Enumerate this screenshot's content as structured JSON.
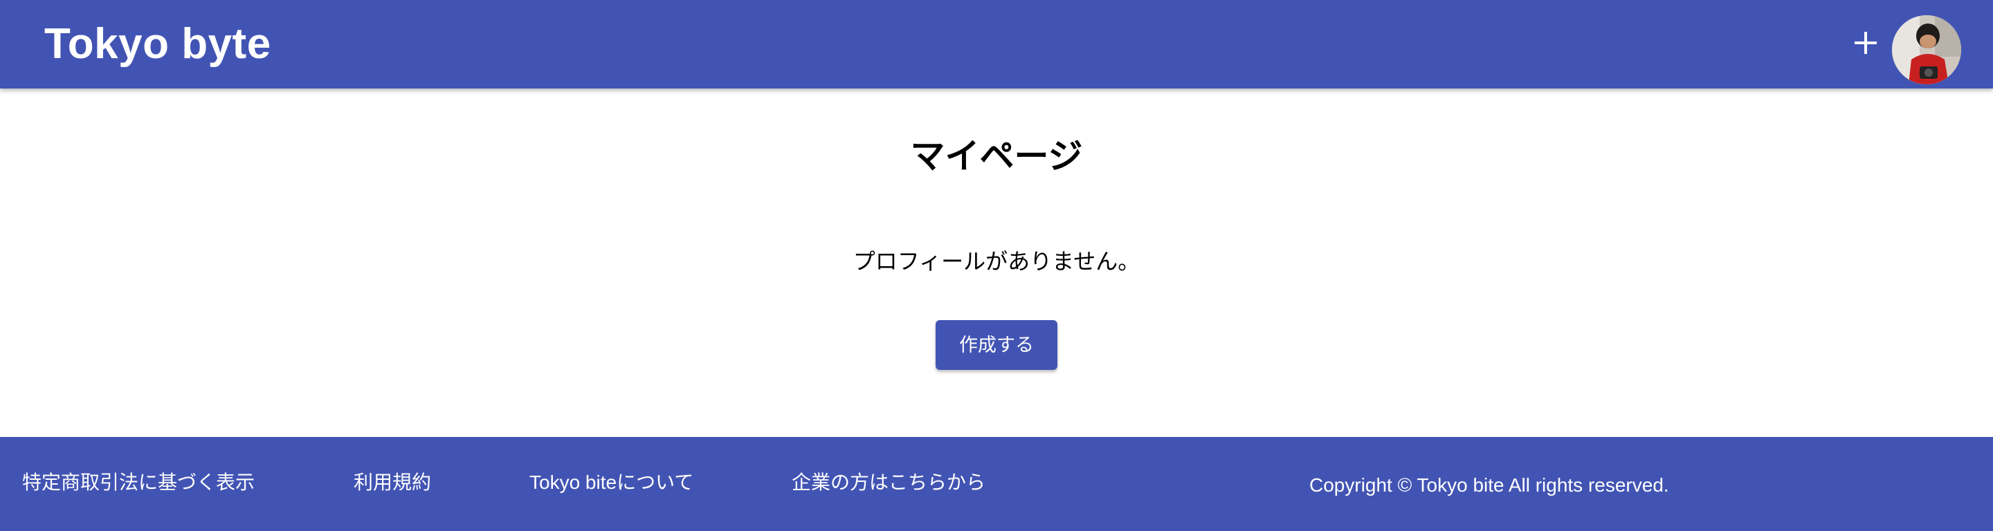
{
  "header": {
    "brand": "Tokyo byte",
    "add_icon": "plus-icon",
    "avatar_icon": "user-avatar"
  },
  "main": {
    "title": "マイページ",
    "empty_message": "プロフィールがありません。",
    "create_button": "作成する"
  },
  "footer": {
    "links": [
      "特定商取引法に基づく表示",
      "利用規約",
      "Tokyo biteについて",
      "企業の方はこちらから"
    ],
    "copyright": "Copyright © Tokyo bite All rights reserved."
  },
  "colors": {
    "primary": "#4254b3",
    "background": "#ffffff",
    "text": "#000000",
    "on_primary": "#ffffff"
  }
}
